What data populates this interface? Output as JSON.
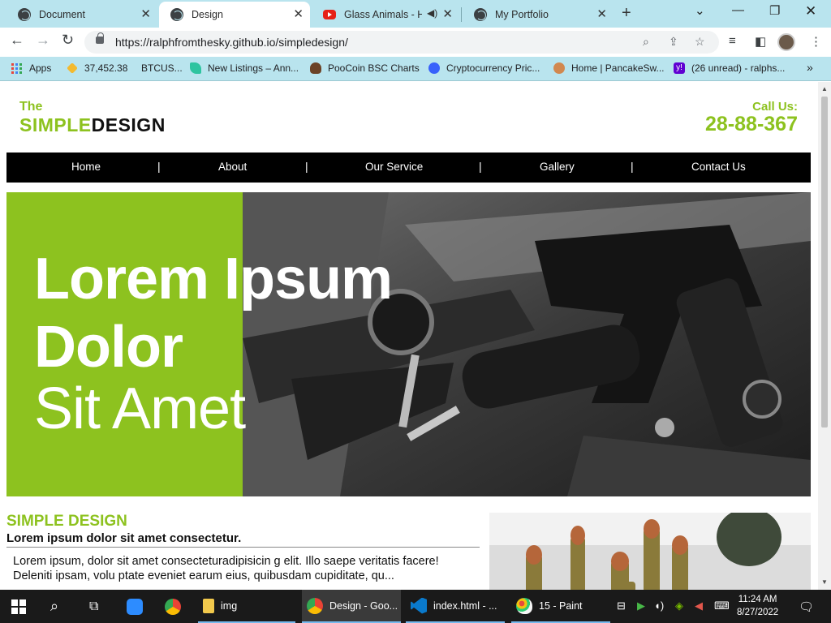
{
  "browser": {
    "tabs": [
      {
        "title": "Document",
        "active": false
      },
      {
        "title": "Design",
        "active": true
      },
      {
        "title": "Glass Animals - He",
        "active": false
      },
      {
        "title": "My Portfolio",
        "active": false
      }
    ],
    "url": "https://ralphfromthesky.github.io/simpledesign/",
    "bookmarks": [
      {
        "label": "Apps"
      },
      {
        "label": "37,452.38"
      },
      {
        "label": "BTCUS..."
      },
      {
        "label": "New Listings – Ann..."
      },
      {
        "label": "PooCoin BSC Charts"
      },
      {
        "label": "Cryptocurrency Pric..."
      },
      {
        "label": "Home | PancakeSw..."
      },
      {
        "label": "(26 unread) - ralphs..."
      }
    ]
  },
  "site": {
    "logo_the": "The",
    "logo_simple": "SIMPLE",
    "logo_design": "DESIGN",
    "call_label": "Call Us:",
    "call_number": "28-88-367",
    "nav": [
      "Home",
      "About",
      "Our Service",
      "Gallery",
      "Contact Us"
    ],
    "nav_separator": "|",
    "hero": {
      "line1": "Lorem Ipsum",
      "line2": "Dolor",
      "line3": "Sit Amet",
      "accent": "#8dc21f"
    },
    "section": {
      "title": "SIMPLE DESIGN",
      "subtitle": "Lorem ipsum dolor sit amet consectetur.",
      "body": "Lorem ipsum, dolor sit amet consecteturadipisicin g elit. Illo saepe veritatis facere! Deleniti ipsam, volu ptate eveniet earum eius, quibusdam cupiditate, qu..."
    }
  },
  "taskbar": {
    "items": [
      {
        "label": "img"
      },
      {
        "label": "Design - Goo..."
      },
      {
        "label": "index.html - ..."
      },
      {
        "label": "15 - Paint"
      }
    ],
    "time": "11:24 AM",
    "date": "8/27/2022"
  }
}
